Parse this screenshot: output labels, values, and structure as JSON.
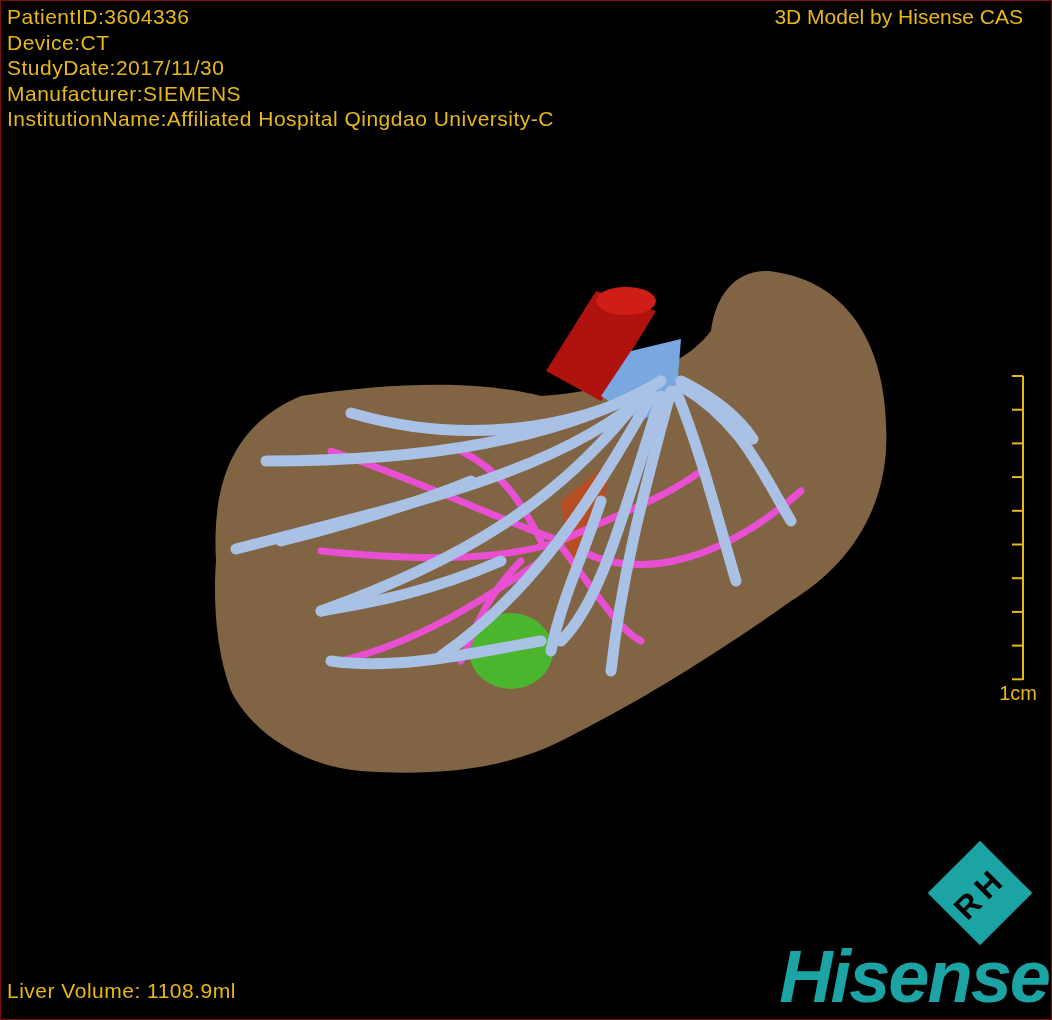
{
  "info_lines": [
    "PatientID:3604336",
    "Device:CT",
    "StudyDate:2017/11/30",
    "Manufacturer:SIEMENS",
    "InstitutionName:Affiliated Hospital Qingdao University-C"
  ],
  "caption": "3D Model by Hisense CAS",
  "scale_bar": {
    "label": "1cm"
  },
  "volume": "Liver Volume: 1108.9ml",
  "logo": {
    "mark": "RH",
    "wordmark": "Hisense"
  }
}
